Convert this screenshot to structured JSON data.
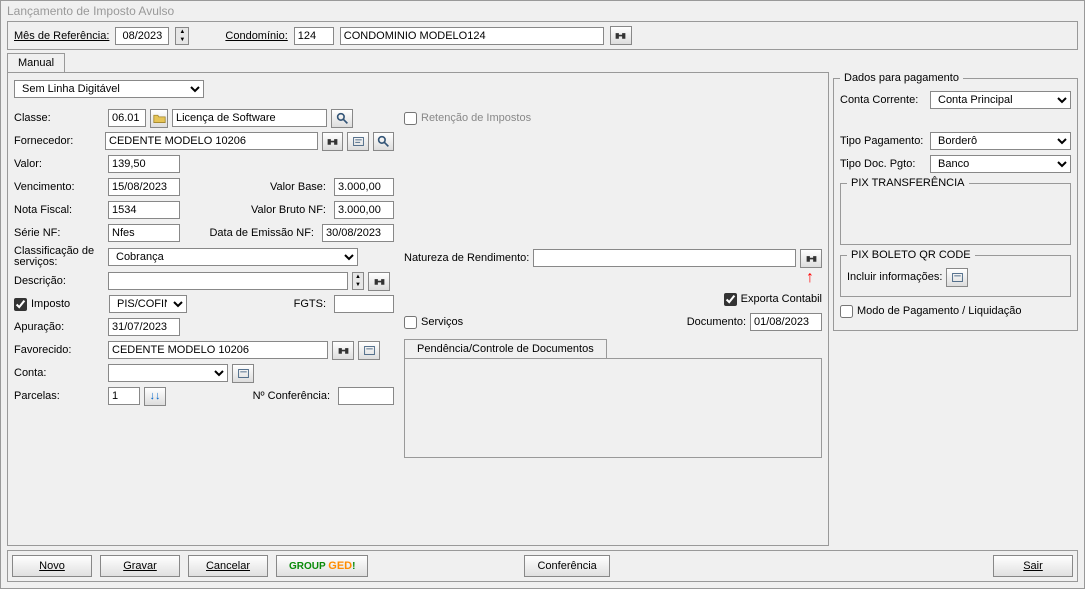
{
  "title": "Lançamento de Imposto Avulso",
  "topbar": {
    "mes_ref_label": "Mês de Referência:",
    "mes_ref_value": "08/2023",
    "condominio_label": "Condomínio:",
    "condominio_code": "124",
    "condominio_name": "CONDOMINIO MODELO124"
  },
  "tabs": {
    "manual": "Manual"
  },
  "dropdown": {
    "linha_digitavel": "Sem Linha Digitável"
  },
  "form": {
    "classe_label": "Classe:",
    "classe_code": "06.01",
    "classe_name": "Licença de Software",
    "fornecedor_label": "Fornecedor:",
    "fornecedor_value": "CEDENTE MODELO 10206",
    "valor_label": "Valor:",
    "valor_value": "139,50",
    "vencimento_label": "Vencimento:",
    "vencimento_value": "15/08/2023",
    "valor_base_label": "Valor Base:",
    "valor_base_value": "3.000,00",
    "nota_fiscal_label": "Nota Fiscal:",
    "nota_fiscal_value": "1534",
    "valor_bruto_label": "Valor Bruto NF:",
    "valor_bruto_value": "3.000,00",
    "serie_nf_label": "Série NF:",
    "serie_nf_value": "Nfes",
    "data_emissao_label": "Data de Emissão NF:",
    "data_emissao_value": "30/08/2023",
    "classificacao_label": "Classificação de serviços:",
    "classificacao_value": "Cobrança",
    "descricao_label": "Descrição:",
    "imposto_label": "Imposto",
    "imposto_select": "PIS/COFINS/CSLL",
    "fgts_label": "FGTS:",
    "apuracao_label": "Apuração:",
    "apuracao_value": "31/07/2023",
    "favorecido_label": "Favorecido:",
    "favorecido_value": "CEDENTE MODELO 10206",
    "conta_label": "Conta:",
    "parcelas_label": "Parcelas:",
    "parcelas_value": "1",
    "num_conferencia_label": "Nº Conferência:"
  },
  "middle": {
    "retencao_label": "Retenção de Impostos",
    "natureza_label": "Natureza de Rendimento:",
    "exporta_contabil_label": "Exporta Contabil",
    "servicos_label": "Serviços",
    "documento_label": "Documento:",
    "documento_value": "01/08/2023",
    "pendencia_tab": "Pendência/Controle de Documentos"
  },
  "payment": {
    "legend": "Dados para pagamento",
    "conta_corrente_label": "Conta Corrente:",
    "conta_corrente_value": "Conta Principal",
    "tipo_pagamento_label": "Tipo Pagamento:",
    "tipo_pagamento_value": "Borderô",
    "tipo_doc_label": "Tipo Doc. Pgto:",
    "tipo_doc_value": "Banco",
    "pix_transferencia": "PIX TRANSFERÊNCIA",
    "pix_boleto": "PIX BOLETO QR CODE",
    "incluir_info": "Incluir informações:",
    "modo_pagamento": "Modo de Pagamento / Liquidação"
  },
  "buttons": {
    "novo": "Novo",
    "gravar": "Gravar",
    "cancelar": "Cancelar",
    "conferencia": "Conferência",
    "sair": "Sair"
  }
}
